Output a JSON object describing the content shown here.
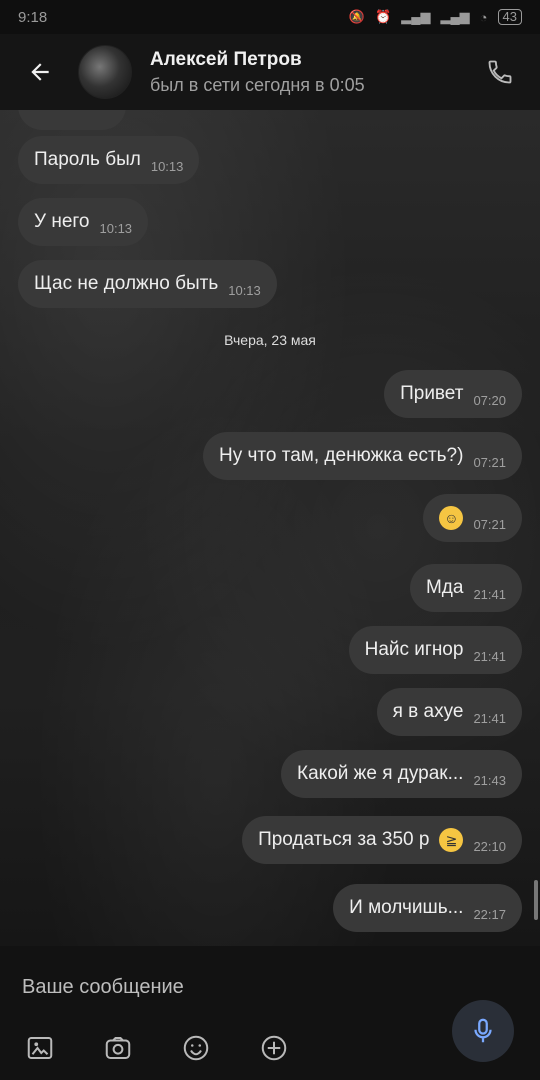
{
  "status": {
    "time": "9:18",
    "battery": "43"
  },
  "header": {
    "name": "Алексей Петров",
    "lastseen": "был в сети сегодня в 0:05"
  },
  "chat": {
    "date_separator": "Вчера, 23 мая",
    "incoming": [
      {
        "text": "Пароль был",
        "time": "10:13"
      },
      {
        "text": "У него",
        "time": "10:13"
      },
      {
        "text": "Щас не должно быть",
        "time": "10:13"
      }
    ],
    "outgoing": [
      {
        "text": "Привет",
        "time": "07:20"
      },
      {
        "text": "Ну что там, денюжка есть?)",
        "time": "07:21"
      },
      {
        "text": "",
        "time": "07:21"
      },
      {
        "text": "Мда",
        "time": "21:41"
      },
      {
        "text": "Найс игнор",
        "time": "21:41"
      },
      {
        "text": "я в ахуе",
        "time": "21:41"
      },
      {
        "text": "Какой же я дурак...",
        "time": "21:43"
      },
      {
        "text": "Продаться за 350 р",
        "time": "22:10"
      },
      {
        "text": "И молчишь...",
        "time": "22:17"
      }
    ]
  },
  "composer": {
    "placeholder": "Ваше сообщение"
  },
  "icons": [
    "back-arrow-icon",
    "phone-icon",
    "image-icon",
    "camera-icon",
    "emoji-icon",
    "plus-icon",
    "mic-icon"
  ]
}
